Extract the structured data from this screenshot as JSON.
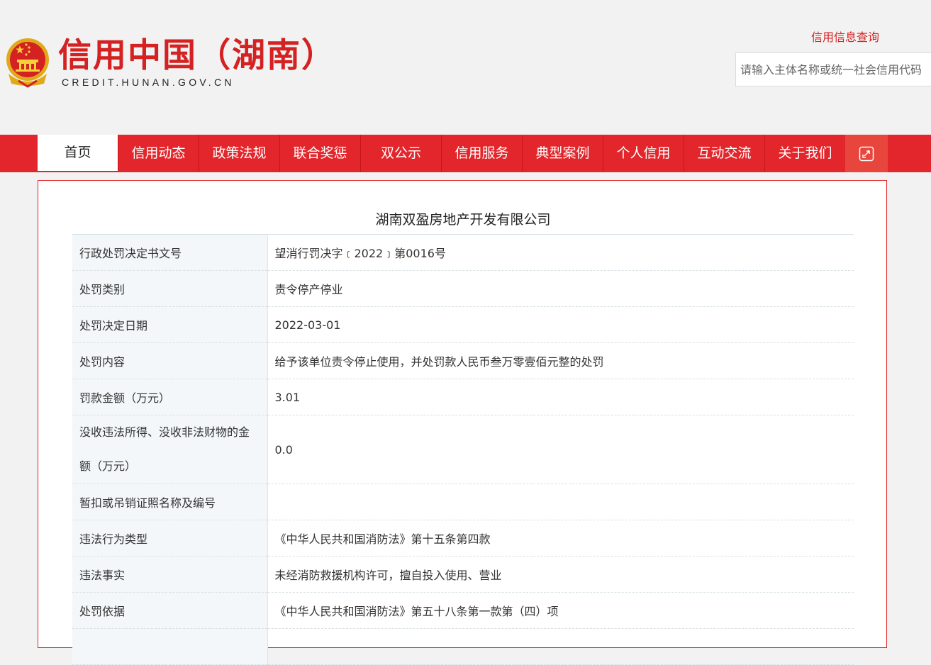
{
  "header": {
    "title": "信用中国（湖南）",
    "subtitle": "CREDIT.HUNAN.GOV.CN",
    "query_label": "信用信息查询",
    "search_placeholder": "请输入主体名称或统一社会信用代码"
  },
  "nav": {
    "items": [
      "首页",
      "信用动态",
      "政策法规",
      "联合奖惩",
      "双公示",
      "信用服务",
      "典型案例",
      "个人信用",
      "互动交流",
      "关于我们"
    ],
    "active_index": 0,
    "expand_icon": "expand-icon"
  },
  "record": {
    "company_name": "湖南双盈房地产开发有限公司",
    "rows": [
      {
        "label": "行政处罚决定书文号",
        "value": "望消行罚决字﹝2022﹞第0016号"
      },
      {
        "label": "处罚类别",
        "value": "责令停产停业"
      },
      {
        "label": "处罚决定日期",
        "value": "2022-03-01"
      },
      {
        "label": "处罚内容",
        "value": "给予该单位责令停止使用，并处罚款人民币叁万零壹佰元整的处罚"
      },
      {
        "label": "罚款金额（万元）",
        "value": "3.01"
      },
      {
        "label": "没收违法所得、没收非法财物的金额（万元）",
        "value": "0.0"
      },
      {
        "label": "暂扣或吊销证照名称及编号",
        "value": ""
      },
      {
        "label": "违法行为类型",
        "value": "《中华人民共和国消防法》第十五条第四款"
      },
      {
        "label": "违法事实",
        "value": "未经消防救援机构许可，擅自投入使用、营业"
      },
      {
        "label": "处罚依据",
        "value": "《中华人民共和国消防法》第五十八条第一款第（四）项"
      },
      {
        "label": "",
        "value": ""
      }
    ]
  },
  "colors": {
    "brand_red": "#e2262b",
    "title_red": "#d42121",
    "label_bg": "#f3f7f9"
  }
}
